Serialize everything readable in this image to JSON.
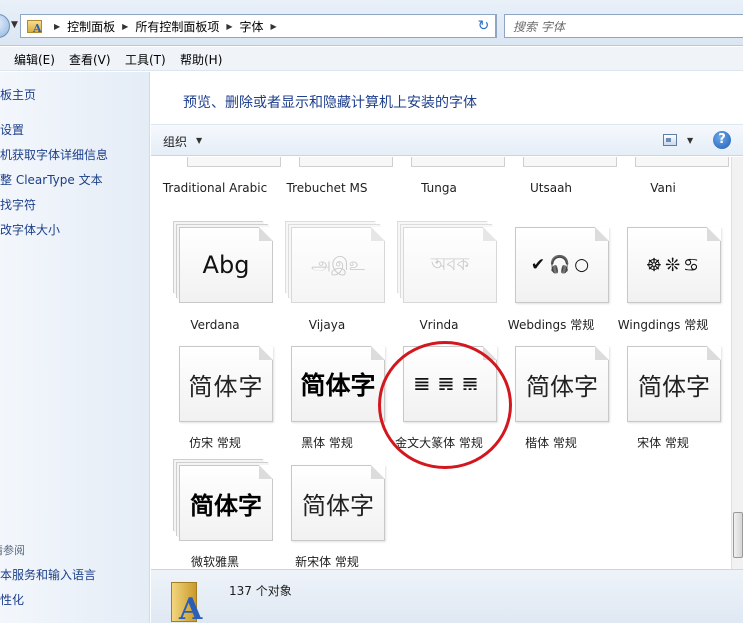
{
  "address": {
    "breadcrumbs": [
      "控制面板",
      "所有控制面板项",
      "字体"
    ],
    "search_placeholder": "搜索 字体"
  },
  "menu": [
    "编辑(E)",
    "查看(V)",
    "工具(T)",
    "帮助(H)"
  ],
  "sidebar": {
    "tasks": [
      "面板主页",
      "体设置",
      "联机获取字体详细信息",
      "调整 ClearType 文本",
      "查找字符",
      "更改字体大小"
    ],
    "see_also_title": "请参阅",
    "see_also": [
      "文本服务和输入语言",
      "个性化"
    ]
  },
  "header": {
    "title": "预览、删除或者显示和隐藏计算机上安装的字体"
  },
  "toolbar": {
    "organize": "组织"
  },
  "fonts": {
    "row1": [
      {
        "name": "Traditional Arabic"
      },
      {
        "name": "Trebuchet MS"
      },
      {
        "name": "Tunga"
      },
      {
        "name": "Utsaah"
      },
      {
        "name": "Vani"
      }
    ],
    "row2": [
      {
        "name": "Verdana",
        "sample": "Abg"
      },
      {
        "name": "Vijaya",
        "sample": "அஇஉ"
      },
      {
        "name": "Vrinda",
        "sample": "অবক"
      },
      {
        "name": "Webdings 常规",
        "sample": "✔🎧○"
      },
      {
        "name": "Wingdings 常规",
        "sample": "☸❊♋"
      }
    ],
    "row3": [
      {
        "name": "仿宋 常规",
        "sample": "简体字"
      },
      {
        "name": "黑体 常规",
        "sample": "简体字"
      },
      {
        "name": "金文大篆体 常规",
        "sample": "𝌆𝌇𝌈"
      },
      {
        "name": "楷体 常规",
        "sample": "简体字"
      },
      {
        "name": "宋体 常规",
        "sample": "简体字"
      }
    ],
    "row4": [
      {
        "name": "微软雅黑",
        "sample": "简体字"
      },
      {
        "name": "新宋体 常规",
        "sample": "简体字"
      }
    ]
  },
  "status": {
    "count": "137 个对象"
  },
  "icons": {
    "back": "nav-back-icon",
    "folder": "fonts-folder-icon",
    "refresh": "refresh-icon",
    "search": "search-icon",
    "view": "view-options-icon",
    "help": "help-icon"
  },
  "colors": {
    "annotation": "#d2181e",
    "link": "#1c3f8a",
    "title": "#1e3f8c"
  }
}
